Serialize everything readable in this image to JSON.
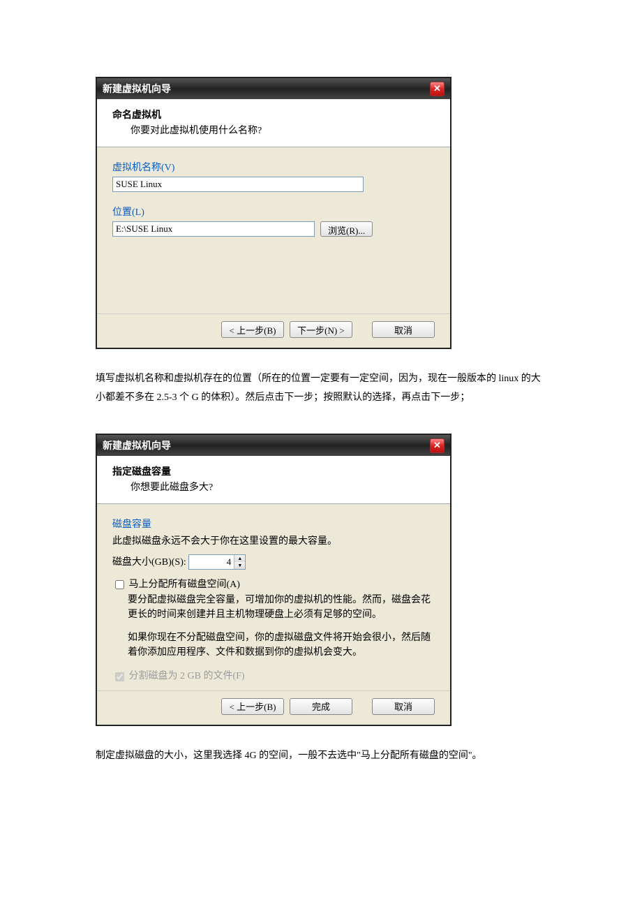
{
  "dialog1": {
    "title": "新建虚拟机向导",
    "head_title": "命名虚拟机",
    "head_sub": "你要对此虚拟机使用什么名称?",
    "vm_name_label": "虚拟机名称(V)",
    "vm_name_value": "SUSE Linux",
    "location_label": "位置(L)",
    "location_value": "E:\\SUSE Linux",
    "browse_btn": "浏览(R)...",
    "back_btn": "< 上一步(B)",
    "next_btn": "下一步(N) >",
    "cancel_btn": "取消"
  },
  "para1": "填写虚拟机名称和虚拟机存在的位置（所在的位置一定要有一定空间，因为，现在一般版本的 linux 的大小都差不多在 2.5-3 个 G 的体积）。然后点击下一步；按照默认的选择，再点击下一步；",
  "dialog2": {
    "title": "新建虚拟机向导",
    "head_title": "指定磁盘容量",
    "head_sub": "你想要此磁盘多大?",
    "capacity_label": "磁盘容量",
    "capacity_desc": "此虚拟磁盘永远不会大于你在这里设置的最大容量。",
    "size_label": "磁盘大小(GB)(S):",
    "size_value": "4",
    "allocate_label": "马上分配所有磁盘空间(A)",
    "allocate_desc1": "要分配虚拟磁盘完全容量，可增加你的虚拟机的性能。然而，磁盘会花更长的时间来创建并且主机物理硬盘上必须有足够的空间。",
    "allocate_desc2": "如果你现在不分配磁盘空间，你的虚拟磁盘文件将开始会很小，然后随着你添加应用程序、文件和数据到你的虚拟机会变大。",
    "split_label": "分割磁盘为 2 GB 的文件(F)",
    "back_btn": "< 上一步(B)",
    "finish_btn": "完成",
    "cancel_btn": "取消"
  },
  "para2": "制定虚拟磁盘的大小，这里我选择 4G 的空间，一般不去选中\"马上分配所有磁盘的空间\"。"
}
